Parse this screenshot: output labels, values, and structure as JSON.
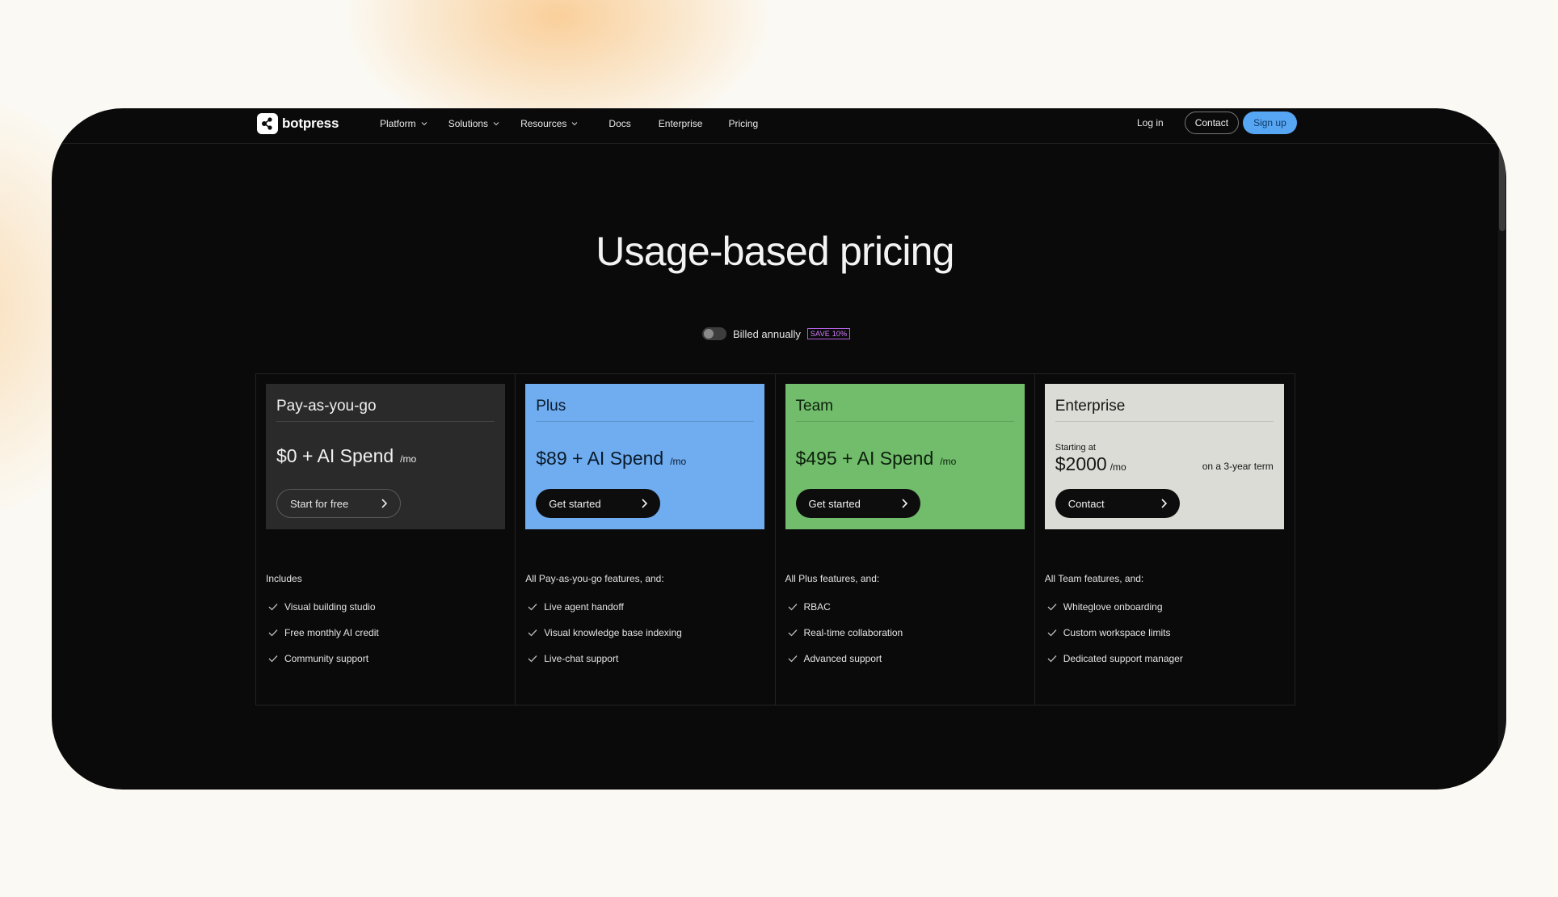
{
  "brand": {
    "name": "botpress"
  },
  "nav": {
    "links": [
      {
        "label": "Platform",
        "has_dropdown": true
      },
      {
        "label": "Solutions",
        "has_dropdown": true
      },
      {
        "label": "Resources",
        "has_dropdown": true
      },
      {
        "label": "Docs",
        "has_dropdown": false
      },
      {
        "label": "Enterprise",
        "has_dropdown": false
      },
      {
        "label": "Pricing",
        "has_dropdown": false
      }
    ],
    "login_label": "Log in",
    "contact_label": "Contact",
    "signup_label": "Sign up"
  },
  "hero": {
    "title": "Usage-based pricing"
  },
  "billing": {
    "label": "Billed annually",
    "badge": "SAVE 10%",
    "annual_enabled": false
  },
  "plans": [
    {
      "name": "Pay-as-you-go",
      "price": "$0 + AI Spend",
      "period": "/mo",
      "cta": "Start for free",
      "features_title": "Includes",
      "features": [
        "Visual building studio",
        "Free monthly AI credit",
        "Community support"
      ],
      "card_color": "#2a2a2a"
    },
    {
      "name": "Plus",
      "price": "$89 + AI Spend",
      "period": "/mo",
      "cta": "Get started",
      "features_title": "All Pay-as-you-go features, and:",
      "features": [
        "Live agent handoff",
        "Visual knowledge base indexing",
        "Live-chat support"
      ],
      "card_color": "#6fadf0"
    },
    {
      "name": "Team",
      "price": "$495 + AI Spend",
      "period": "/mo",
      "cta": "Get started",
      "features_title": "All Plus features, and:",
      "features": [
        "RBAC",
        "Real-time collaboration",
        "Advanced support"
      ],
      "card_color": "#71bd6c"
    },
    {
      "name": "Enterprise",
      "starting_label": "Starting at",
      "price": "$2000",
      "period": "/mo",
      "term": "on a 3-year term",
      "cta": "Contact",
      "features_title": "All Team features, and:",
      "features": [
        "Whiteglove onboarding",
        "Custom workspace limits",
        "Dedicated support manager"
      ],
      "card_color": "#dcdcd6"
    }
  ],
  "colors": {
    "accent": "#56a6f4",
    "frame_bg": "#0a0a0a",
    "page_bg": "#fbf9f3",
    "badge": "#d680ff"
  }
}
